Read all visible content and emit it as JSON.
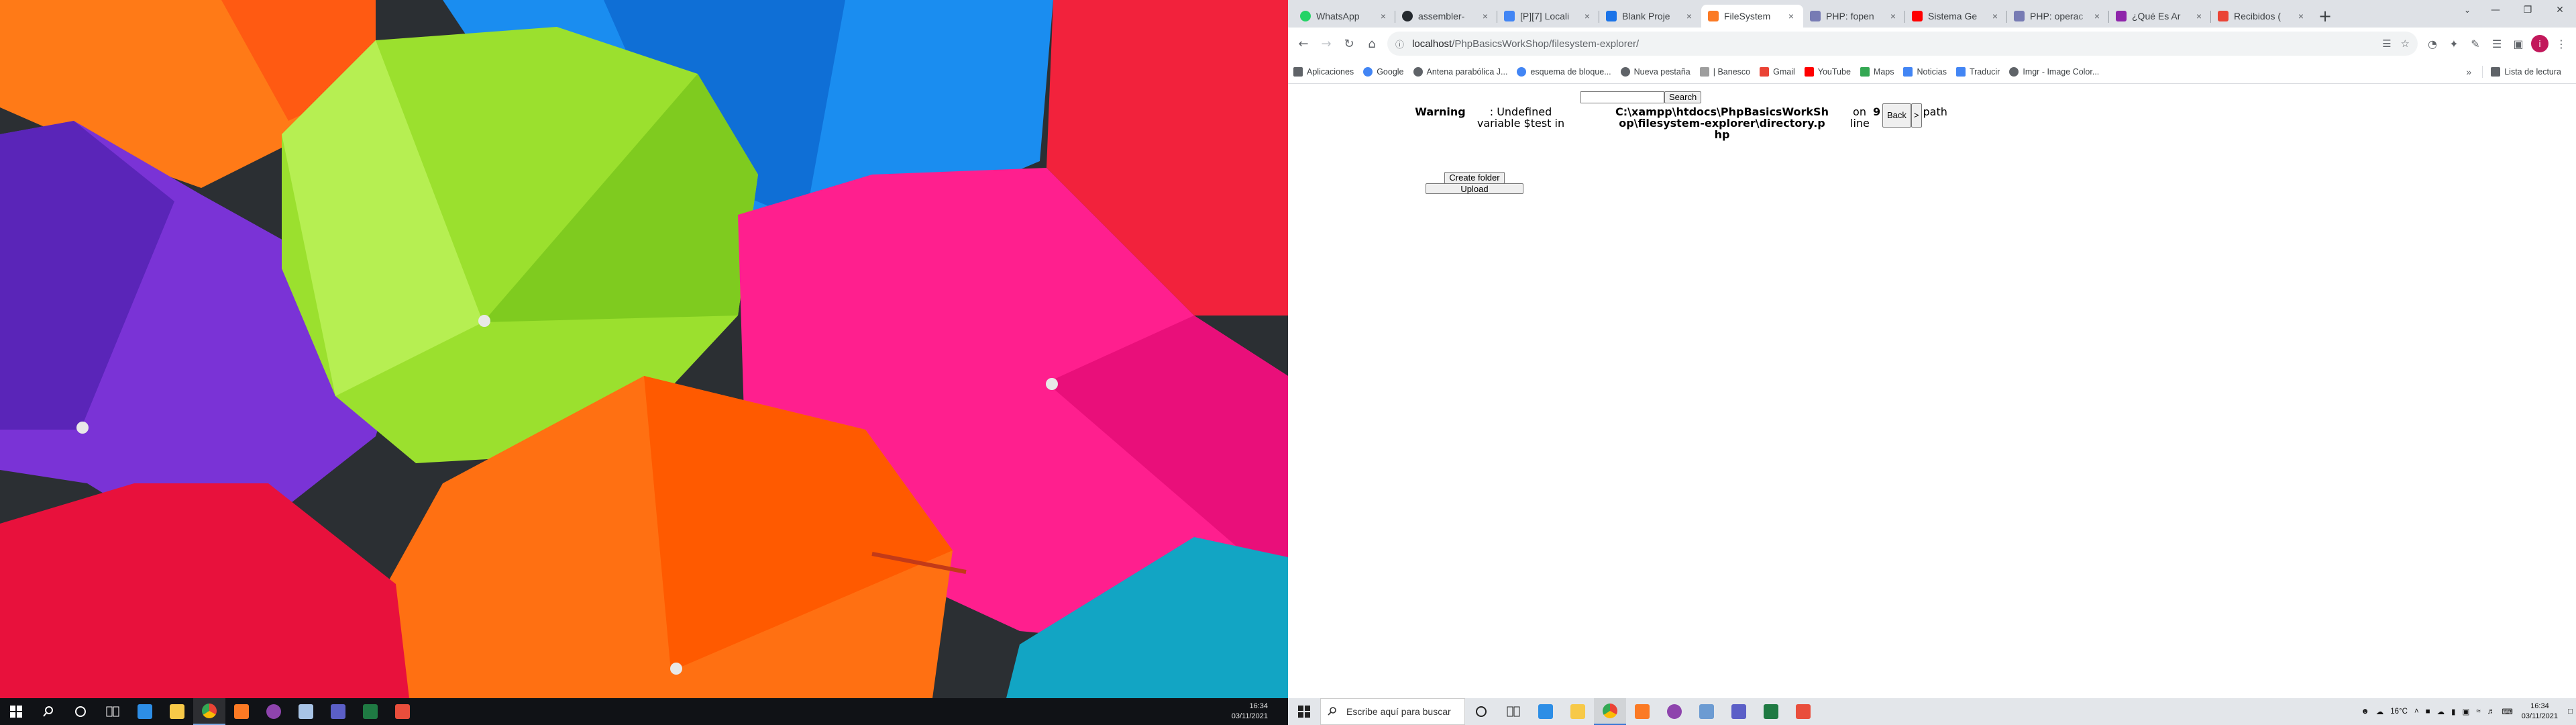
{
  "left_monitor": {
    "wallpaper_icon": "umbrella-wallpaper",
    "taskbar": {
      "icons": [
        "windows-logo-icon",
        "search-icon",
        "cortana-icon",
        "task-view-icon",
        "vscode-icon",
        "file-explorer-icon",
        "chrome-icon",
        "xampp-icon",
        "github-desktop-icon",
        "notepad-icon",
        "teams-icon",
        "excel-icon",
        "paint-icon"
      ],
      "clock_time": "16:34",
      "clock_date": "03/11/2021"
    }
  },
  "browser": {
    "tabs": [
      {
        "title": "WhatsApp",
        "icon": "whatsapp-icon",
        "color": "#25d366"
      },
      {
        "title": "assembler-",
        "icon": "github-icon",
        "color": "#24292e"
      },
      {
        "title": "[P][7] Locali",
        "icon": "docs-icon",
        "color": "#4285f4"
      },
      {
        "title": "Blank Proje",
        "icon": "m-icon",
        "color": "#1a73e8"
      },
      {
        "title": "FileSystem",
        "icon": "xampp-icon",
        "color": "#fb7a24",
        "active": true
      },
      {
        "title": "PHP: fopen",
        "icon": "php-icon",
        "color": "#777bb4"
      },
      {
        "title": "Sistema Ge",
        "icon": "youtube-icon",
        "color": "#ff0000"
      },
      {
        "title": "PHP: operac",
        "icon": "php-icon",
        "color": "#777bb4"
      },
      {
        "title": "¿Qué Es Ar",
        "icon": "m-icon",
        "color": "#8e24aa"
      },
      {
        "title": "Recibidos (",
        "icon": "gmail-icon",
        "color": "#ea4335"
      }
    ],
    "close_glyph": "×",
    "new_tab_glyph": "+",
    "address": {
      "host": "localhost",
      "path": "/PhpBasicsWorkShop/filesystem-explorer/"
    },
    "profile_initial": "i",
    "bookmarks": [
      {
        "label": "Aplicaciones",
        "icon": "apps-grid-icon",
        "color": "#5f6368"
      },
      {
        "label": "Google",
        "icon": "google-icon",
        "color": "#4285f4"
      },
      {
        "label": "Antena parabólica J...",
        "icon": "globe-icon",
        "color": "#5f6368"
      },
      {
        "label": "esquema de bloque...",
        "icon": "google-icon",
        "color": "#4285f4"
      },
      {
        "label": "Nueva pestaña",
        "icon": "globe-icon",
        "color": "#5f6368"
      },
      {
        "label": "| Banesco",
        "icon": "document-icon",
        "color": "#9e9e9e"
      },
      {
        "label": "Gmail",
        "icon": "gmail-icon",
        "color": "#ea4335"
      },
      {
        "label": "YouTube",
        "icon": "youtube-icon",
        "color": "#ff0000"
      },
      {
        "label": "Maps",
        "icon": "maps-icon",
        "color": "#34a853"
      },
      {
        "label": "Noticias",
        "icon": "news-icon",
        "color": "#4285f4"
      },
      {
        "label": "Traducir",
        "icon": "translate-icon",
        "color": "#4285f4"
      },
      {
        "label": "Imgr - Image Color...",
        "icon": "globe-icon",
        "color": "#5f6368"
      }
    ],
    "bookmarks_more": "»",
    "reading_list": "Lista de lectura"
  },
  "page": {
    "search_button": "Search",
    "search_value": "",
    "warning": {
      "label": "Warning",
      "message": ": Undefined variable $test in",
      "file": "C:\\xampp\\htdocs\\PhpBasicsWorkShop\\filesystem-explorer\\directory.php",
      "on_line": "on line",
      "line_number": "9",
      "back_button": "Back",
      "next_button": ">",
      "path_label": "path"
    },
    "create_folder_button": "Create folder",
    "upload_button": "Upload"
  },
  "right_taskbar": {
    "search_placeholder": "Escribe aquí para buscar",
    "icons": [
      "cortana-icon",
      "task-view-icon",
      "vscode-icon",
      "file-explorer-icon",
      "chrome-icon",
      "xampp-icon",
      "github-desktop-icon",
      "notepad-icon",
      "teams-icon",
      "excel-icon",
      "paint-icon"
    ],
    "weather": "16°C",
    "clock_time": "16:34",
    "clock_date": "03/11/2021"
  }
}
